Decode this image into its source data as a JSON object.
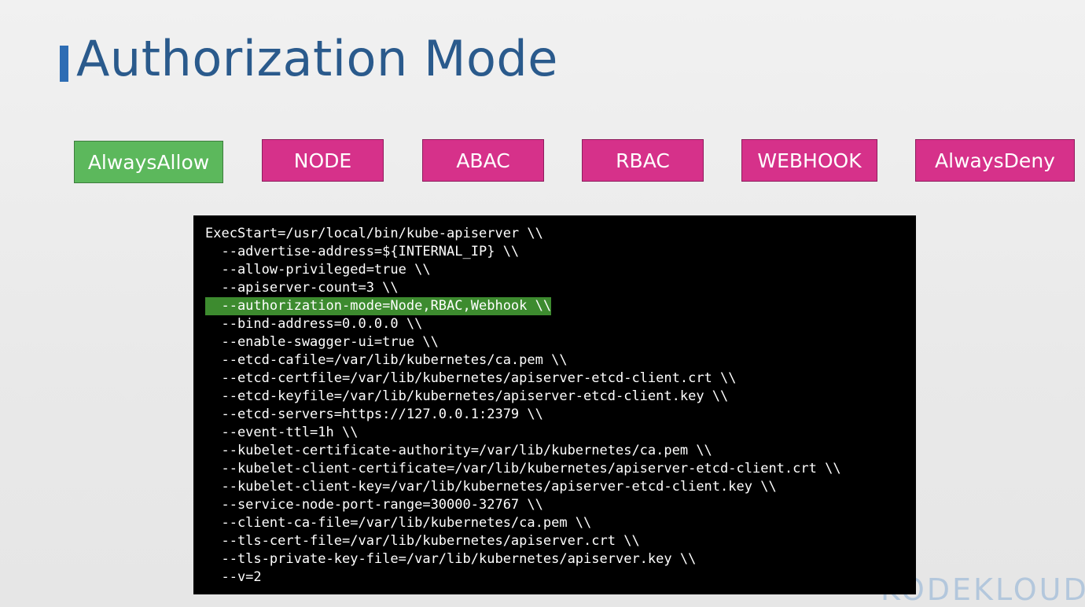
{
  "slide": {
    "title": "Authorization Mode",
    "accent_color": "#2e6db4",
    "title_color": "#2a5a8c"
  },
  "modes": [
    {
      "label": "AlwaysAllow",
      "state": "selected",
      "color": "#5cb85c"
    },
    {
      "label": "NODE",
      "state": "normal",
      "color": "#d6318a"
    },
    {
      "label": "ABAC",
      "state": "normal",
      "color": "#d6318a"
    },
    {
      "label": "RBAC",
      "state": "normal",
      "color": "#d6318a"
    },
    {
      "label": "WEBHOOK",
      "state": "normal",
      "color": "#d6318a"
    },
    {
      "label": "AlwaysDeny",
      "state": "normal",
      "color": "#d6318a"
    }
  ],
  "terminal": {
    "highlight_color": "#3d8b2f",
    "highlighted_line_index": 4,
    "lines": [
      "ExecStart=/usr/local/bin/kube-apiserver \\\\",
      "  --advertise-address=${INTERNAL_IP} \\\\",
      "  --allow-privileged=true \\\\",
      "  --apiserver-count=3 \\\\",
      "  --authorization-mode=Node,RBAC,Webhook \\\\",
      "  --bind-address=0.0.0.0 \\\\",
      "  --enable-swagger-ui=true \\\\",
      "  --etcd-cafile=/var/lib/kubernetes/ca.pem \\\\",
      "  --etcd-certfile=/var/lib/kubernetes/apiserver-etcd-client.crt \\\\",
      "  --etcd-keyfile=/var/lib/kubernetes/apiserver-etcd-client.key \\\\",
      "  --etcd-servers=https://127.0.0.1:2379 \\\\",
      "  --event-ttl=1h \\\\",
      "  --kubelet-certificate-authority=/var/lib/kubernetes/ca.pem \\\\",
      "  --kubelet-client-certificate=/var/lib/kubernetes/apiserver-etcd-client.crt \\\\",
      "  --kubelet-client-key=/var/lib/kubernetes/apiserver-etcd-client.key \\\\",
      "  --service-node-port-range=30000-32767 \\\\",
      "  --client-ca-file=/var/lib/kubernetes/ca.pem \\\\",
      "  --tls-cert-file=/var/lib/kubernetes/apiserver.crt \\\\",
      "  --tls-private-key-file=/var/lib/kubernetes/apiserver.key \\\\",
      "  --v=2"
    ]
  },
  "logo": {
    "text": "KODEKLOUD"
  }
}
